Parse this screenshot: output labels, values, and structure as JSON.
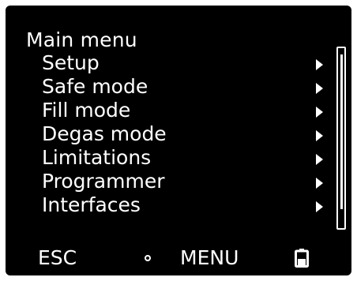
{
  "screen": {
    "title": "Main menu",
    "menu_items": [
      {
        "label": "Setup",
        "icon": "chevron-right-icon"
      },
      {
        "label": "Safe mode",
        "icon": "chevron-right-icon"
      },
      {
        "label": "Fill mode",
        "icon": "chevron-right-icon"
      },
      {
        "label": "Degas mode",
        "icon": "chevron-right-icon"
      },
      {
        "label": "Limitations",
        "icon": "chevron-right-icon"
      },
      {
        "label": "Programmer",
        "icon": "chevron-right-icon"
      },
      {
        "label": "Interfaces",
        "icon": "chevron-right-icon"
      }
    ],
    "scroll_position": 0
  },
  "footer": {
    "esc_label": "ESC",
    "center_icon": "circle-icon",
    "menu_label": "MENU",
    "status_icon": "battery-icon"
  },
  "colors": {
    "background": "#000000",
    "foreground": "#ffffff"
  }
}
